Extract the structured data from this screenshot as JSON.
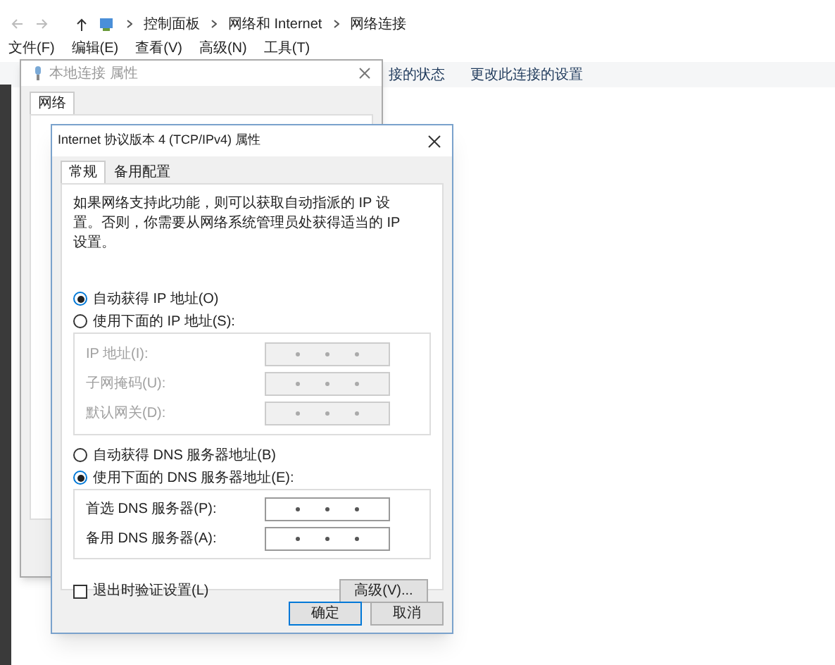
{
  "explorer": {
    "breadcrumb": [
      "控制面板",
      "网络和 Internet",
      "网络连接"
    ],
    "menu": [
      "文件(F)",
      "编辑(E)",
      "查看(V)",
      "高级(N)",
      "工具(T)"
    ],
    "commands": [
      "接的状态",
      "更改此连接的设置"
    ]
  },
  "back_dialog": {
    "title": "本地连接 属性",
    "tabs": [
      {
        "label": "网络",
        "selected": true
      }
    ]
  },
  "dialog": {
    "title": "Internet 协议版本 4 (TCP/IPv4) 属性",
    "tabs": [
      {
        "label": "常规",
        "selected": true
      },
      {
        "label": "备用配置",
        "selected": false
      }
    ],
    "description": "如果网络支持此功能，则可以获取自动指派的 IP 设置。否则，你需要从网络系统管理员处获得适当的 IP 设置。",
    "ip_mode": [
      {
        "label": "自动获得 IP 地址(O)",
        "selected": true
      },
      {
        "label": "使用下面的 IP 地址(S):",
        "selected": false
      }
    ],
    "ip_fields": [
      {
        "label": "IP 地址(I):",
        "disabled": true
      },
      {
        "label": "子网掩码(U):",
        "disabled": true
      },
      {
        "label": "默认网关(D):",
        "disabled": true
      }
    ],
    "dns_mode": [
      {
        "label": "自动获得 DNS 服务器地址(B)",
        "selected": false
      },
      {
        "label": "使用下面的 DNS 服务器地址(E):",
        "selected": true
      }
    ],
    "dns_fields": [
      {
        "label": "首选 DNS 服务器(P):",
        "disabled": false
      },
      {
        "label": "备用 DNS 服务器(A):",
        "disabled": false
      }
    ],
    "validate": {
      "label": "退出时验证设置(L)",
      "checked": false
    },
    "advanced": "高级(V)...",
    "buttons": [
      {
        "label": "确定",
        "default": true
      },
      {
        "label": "取消",
        "default": false
      }
    ]
  }
}
